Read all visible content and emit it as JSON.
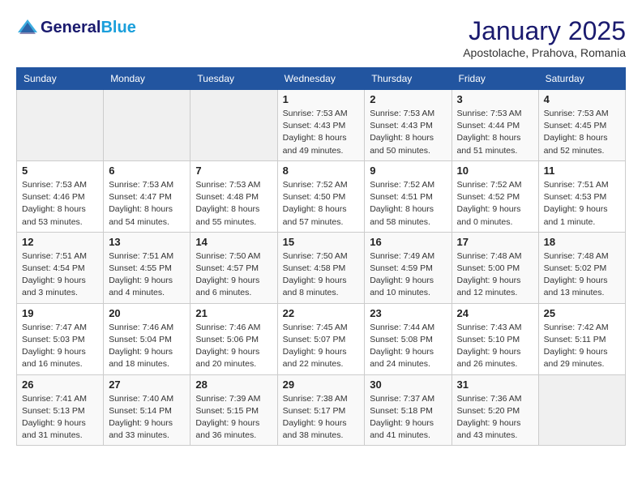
{
  "header": {
    "logo_line1": "General",
    "logo_line2": "Blue",
    "month": "January 2025",
    "location": "Apostolache, Prahova, Romania"
  },
  "weekdays": [
    "Sunday",
    "Monday",
    "Tuesday",
    "Wednesday",
    "Thursday",
    "Friday",
    "Saturday"
  ],
  "weeks": [
    [
      {
        "day": "",
        "info": ""
      },
      {
        "day": "",
        "info": ""
      },
      {
        "day": "",
        "info": ""
      },
      {
        "day": "1",
        "info": "Sunrise: 7:53 AM\nSunset: 4:43 PM\nDaylight: 8 hours\nand 49 minutes."
      },
      {
        "day": "2",
        "info": "Sunrise: 7:53 AM\nSunset: 4:43 PM\nDaylight: 8 hours\nand 50 minutes."
      },
      {
        "day": "3",
        "info": "Sunrise: 7:53 AM\nSunset: 4:44 PM\nDaylight: 8 hours\nand 51 minutes."
      },
      {
        "day": "4",
        "info": "Sunrise: 7:53 AM\nSunset: 4:45 PM\nDaylight: 8 hours\nand 52 minutes."
      }
    ],
    [
      {
        "day": "5",
        "info": "Sunrise: 7:53 AM\nSunset: 4:46 PM\nDaylight: 8 hours\nand 53 minutes."
      },
      {
        "day": "6",
        "info": "Sunrise: 7:53 AM\nSunset: 4:47 PM\nDaylight: 8 hours\nand 54 minutes."
      },
      {
        "day": "7",
        "info": "Sunrise: 7:53 AM\nSunset: 4:48 PM\nDaylight: 8 hours\nand 55 minutes."
      },
      {
        "day": "8",
        "info": "Sunrise: 7:52 AM\nSunset: 4:50 PM\nDaylight: 8 hours\nand 57 minutes."
      },
      {
        "day": "9",
        "info": "Sunrise: 7:52 AM\nSunset: 4:51 PM\nDaylight: 8 hours\nand 58 minutes."
      },
      {
        "day": "10",
        "info": "Sunrise: 7:52 AM\nSunset: 4:52 PM\nDaylight: 9 hours\nand 0 minutes."
      },
      {
        "day": "11",
        "info": "Sunrise: 7:51 AM\nSunset: 4:53 PM\nDaylight: 9 hours\nand 1 minute."
      }
    ],
    [
      {
        "day": "12",
        "info": "Sunrise: 7:51 AM\nSunset: 4:54 PM\nDaylight: 9 hours\nand 3 minutes."
      },
      {
        "day": "13",
        "info": "Sunrise: 7:51 AM\nSunset: 4:55 PM\nDaylight: 9 hours\nand 4 minutes."
      },
      {
        "day": "14",
        "info": "Sunrise: 7:50 AM\nSunset: 4:57 PM\nDaylight: 9 hours\nand 6 minutes."
      },
      {
        "day": "15",
        "info": "Sunrise: 7:50 AM\nSunset: 4:58 PM\nDaylight: 9 hours\nand 8 minutes."
      },
      {
        "day": "16",
        "info": "Sunrise: 7:49 AM\nSunset: 4:59 PM\nDaylight: 9 hours\nand 10 minutes."
      },
      {
        "day": "17",
        "info": "Sunrise: 7:48 AM\nSunset: 5:00 PM\nDaylight: 9 hours\nand 12 minutes."
      },
      {
        "day": "18",
        "info": "Sunrise: 7:48 AM\nSunset: 5:02 PM\nDaylight: 9 hours\nand 13 minutes."
      }
    ],
    [
      {
        "day": "19",
        "info": "Sunrise: 7:47 AM\nSunset: 5:03 PM\nDaylight: 9 hours\nand 16 minutes."
      },
      {
        "day": "20",
        "info": "Sunrise: 7:46 AM\nSunset: 5:04 PM\nDaylight: 9 hours\nand 18 minutes."
      },
      {
        "day": "21",
        "info": "Sunrise: 7:46 AM\nSunset: 5:06 PM\nDaylight: 9 hours\nand 20 minutes."
      },
      {
        "day": "22",
        "info": "Sunrise: 7:45 AM\nSunset: 5:07 PM\nDaylight: 9 hours\nand 22 minutes."
      },
      {
        "day": "23",
        "info": "Sunrise: 7:44 AM\nSunset: 5:08 PM\nDaylight: 9 hours\nand 24 minutes."
      },
      {
        "day": "24",
        "info": "Sunrise: 7:43 AM\nSunset: 5:10 PM\nDaylight: 9 hours\nand 26 minutes."
      },
      {
        "day": "25",
        "info": "Sunrise: 7:42 AM\nSunset: 5:11 PM\nDaylight: 9 hours\nand 29 minutes."
      }
    ],
    [
      {
        "day": "26",
        "info": "Sunrise: 7:41 AM\nSunset: 5:13 PM\nDaylight: 9 hours\nand 31 minutes."
      },
      {
        "day": "27",
        "info": "Sunrise: 7:40 AM\nSunset: 5:14 PM\nDaylight: 9 hours\nand 33 minutes."
      },
      {
        "day": "28",
        "info": "Sunrise: 7:39 AM\nSunset: 5:15 PM\nDaylight: 9 hours\nand 36 minutes."
      },
      {
        "day": "29",
        "info": "Sunrise: 7:38 AM\nSunset: 5:17 PM\nDaylight: 9 hours\nand 38 minutes."
      },
      {
        "day": "30",
        "info": "Sunrise: 7:37 AM\nSunset: 5:18 PM\nDaylight: 9 hours\nand 41 minutes."
      },
      {
        "day": "31",
        "info": "Sunrise: 7:36 AM\nSunset: 5:20 PM\nDaylight: 9 hours\nand 43 minutes."
      },
      {
        "day": "",
        "info": ""
      }
    ]
  ]
}
